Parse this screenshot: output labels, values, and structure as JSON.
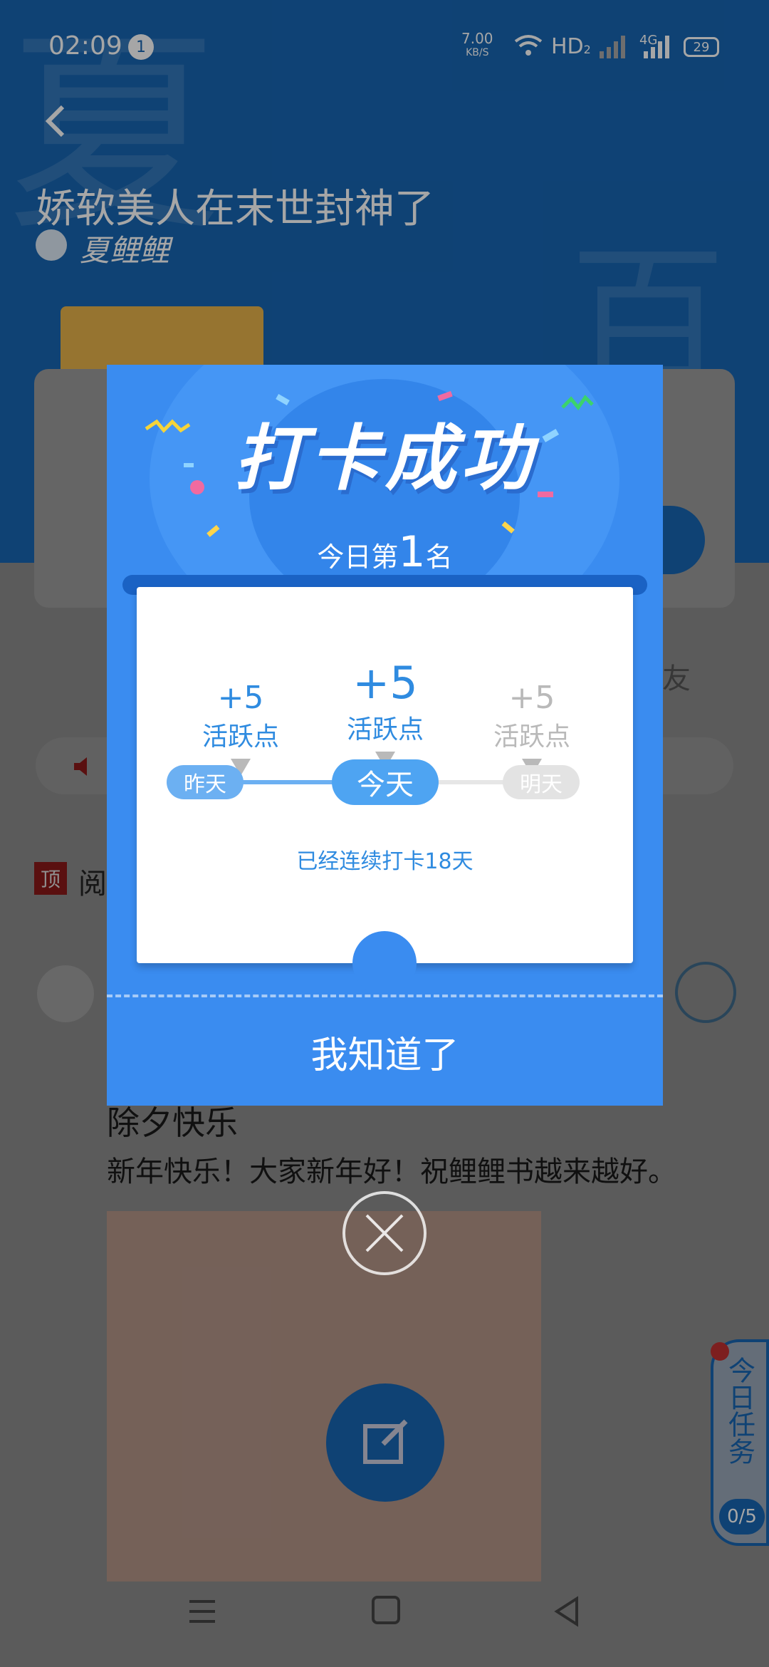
{
  "status_bar": {
    "time": "02:09",
    "notif_count": "1",
    "net_speed_top": "7.00",
    "net_speed_unit": "KB/S",
    "hd": "HD",
    "hd_sub": "2",
    "net_type": "4G",
    "battery": "29"
  },
  "book": {
    "title": "娇软美人在末世封神了",
    "author": "夏鲤鲤",
    "watermark_a": "夏",
    "watermark_b": "百"
  },
  "background": {
    "post_title": "除夕快乐",
    "post_text": "新年快乐！大家新年好！祝鲤鲤书越来越好。",
    "top_tag": "顶",
    "top_label": "阅",
    "side_hint": "友",
    "task_label": "今日任务",
    "task_progress": "0/5"
  },
  "dialog": {
    "title": "打卡成功",
    "rank_prefix": "今日第",
    "rank_number": "1",
    "rank_suffix": "名",
    "days": [
      {
        "points": "+5",
        "label": "活跃点",
        "day": "昨天"
      },
      {
        "points": "+5",
        "label": "活跃点",
        "day": "今天"
      },
      {
        "points": "+5",
        "label": "活跃点",
        "day": "明天"
      }
    ],
    "streak_text": "已经连续打卡18天",
    "confirm_label": "我知道了"
  },
  "colors": {
    "accent": "#3a8cf0",
    "hero_bg": "#1766b3",
    "point_blue": "#2f8be0",
    "inactive": "#b9b9b9"
  },
  "icons": [
    "back-icon",
    "avatar-icon",
    "wifi-icon",
    "signal-icon",
    "battery-icon",
    "close-icon",
    "edit-icon",
    "speaker-icon",
    "menu-icon",
    "home-icon",
    "back-nav-icon"
  ]
}
